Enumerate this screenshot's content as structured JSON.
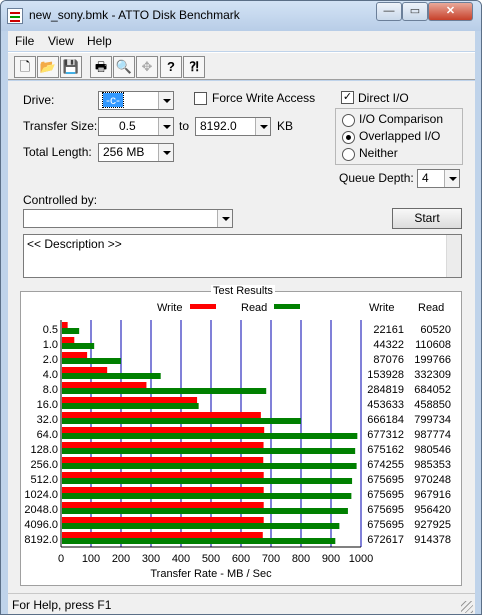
{
  "window": {
    "title": "new_sony.bmk - ATTO Disk Benchmark",
    "controls": [
      "minimize-icon",
      "maximize-icon",
      "close-icon"
    ],
    "controls_glyphs": [
      "—",
      "▭",
      "✕"
    ]
  },
  "menu": [
    "File",
    "View",
    "Help"
  ],
  "toolbar": {
    "icons": [
      "new-document-icon",
      "open-folder-icon",
      "save-icon",
      "print-icon",
      "print-preview-icon",
      "move-icon",
      "help-icon",
      "context-help-icon"
    ],
    "glyphs": [
      "🗋",
      "📂",
      "💾",
      "🖶",
      "🔍",
      "✥",
      "?",
      "⁈"
    ]
  },
  "settings": {
    "drive_label": "Drive:",
    "drive_value": "-c-",
    "force_write_label": "Force Write Access",
    "force_write_checked": false,
    "direct_io_label": "Direct I/O",
    "direct_io_checked": true,
    "transfer_size_label": "Transfer Size:",
    "transfer_size_from": "0.5",
    "to_label": "to",
    "transfer_size_to": "8192.0",
    "kb_label": "KB",
    "total_length_label": "Total Length:",
    "total_length_value": "256 MB",
    "io_comparison_label": "I/O Comparison",
    "overlapped_io_label": "Overlapped I/O",
    "neither_label": "Neither",
    "selected_io_mode": "Overlapped I/O",
    "queue_depth_label": "Queue Depth:",
    "queue_depth_value": "4",
    "controlled_by_label": "Controlled by:",
    "controlled_by_value": "",
    "start_label": "Start",
    "description": "<< Description >>",
    "check_glyph": "✓"
  },
  "results": {
    "title": "Test Results",
    "write_legend": "Write",
    "read_legend": "Read",
    "write_col": "Write",
    "read_col": "Read",
    "write_color": "#ff0000",
    "read_color": "#008000",
    "grid_color": "#0000b0"
  },
  "chart_data": {
    "type": "bar",
    "orientation": "horizontal",
    "categories": [
      "0.5",
      "1.0",
      "2.0",
      "4.0",
      "8.0",
      "16.0",
      "32.0",
      "64.0",
      "128.0",
      "256.0",
      "512.0",
      "1024.0",
      "2048.0",
      "4096.0",
      "8192.0"
    ],
    "series": [
      {
        "name": "Write",
        "values": [
          22161,
          44322,
          87076,
          153928,
          284819,
          453633,
          666184,
          677312,
          675162,
          674255,
          675695,
          675695,
          675695,
          675695,
          672617
        ]
      },
      {
        "name": "Read",
        "values": [
          60520,
          110608,
          199766,
          332309,
          684052,
          458850,
          799734,
          987774,
          980546,
          985353,
          970248,
          967916,
          956420,
          927925,
          914378
        ]
      }
    ],
    "xlabel": "Transfer Rate - MB / Sec",
    "xlim": [
      0,
      1000
    ],
    "xticks": [
      "0",
      "100",
      "200",
      "300",
      "400",
      "500",
      "600",
      "700",
      "800",
      "900",
      "1000"
    ],
    "grid": true
  },
  "status": {
    "text": "For Help, press F1"
  }
}
